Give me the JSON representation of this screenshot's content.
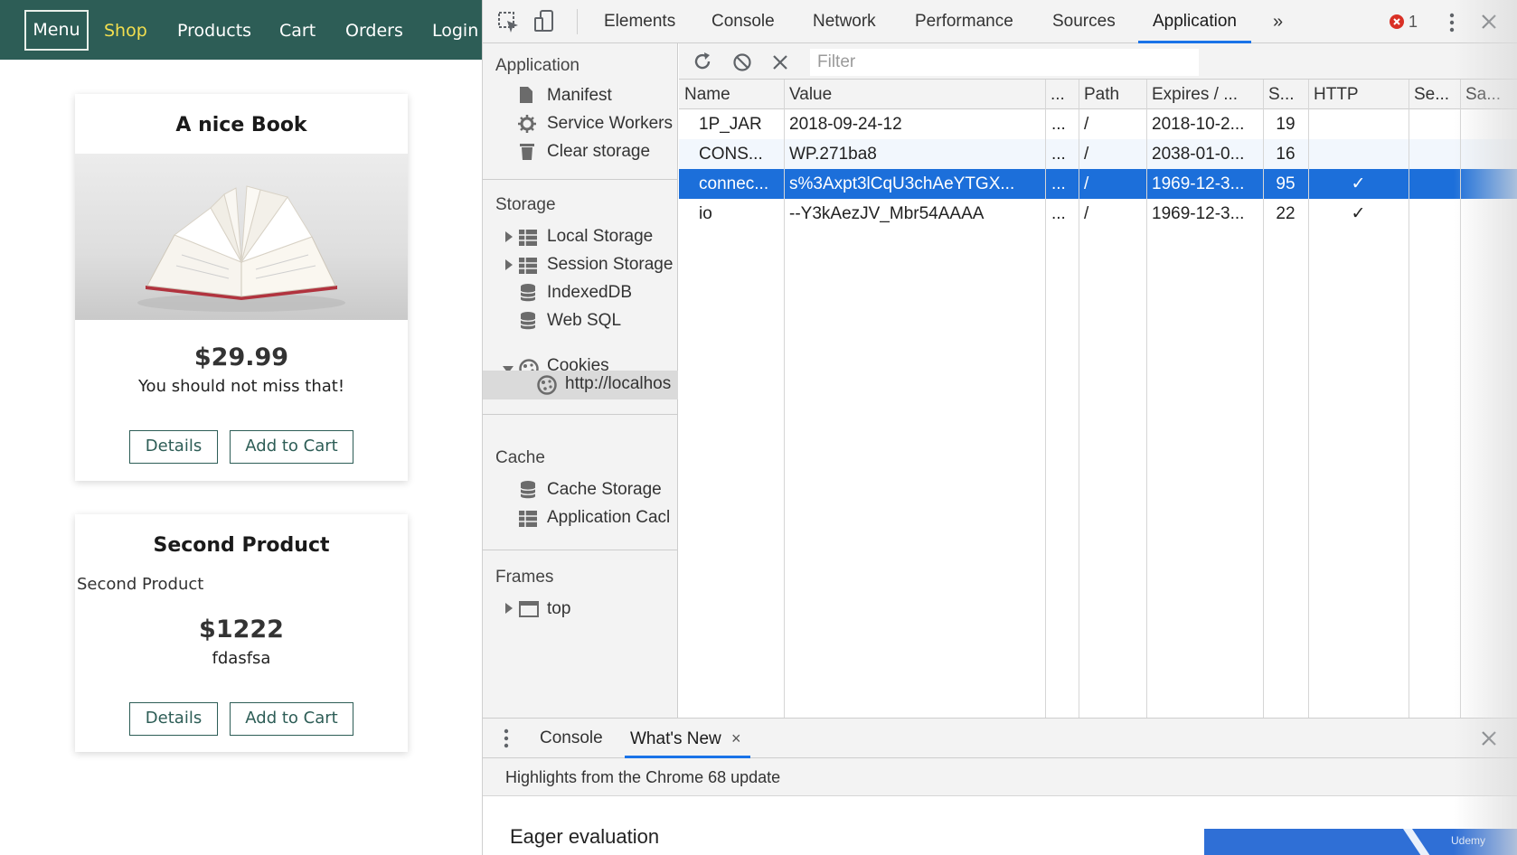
{
  "site": {
    "nav": {
      "menu": "Menu",
      "items": [
        "Shop",
        "Products",
        "Cart",
        "Orders",
        "Login"
      ],
      "active": "Shop"
    },
    "products": [
      {
        "title": "A nice Book",
        "image_alt": "",
        "image_icon": "open-book-image",
        "price": "$29.99",
        "description": "You should not miss that!",
        "details_label": "Details",
        "add_label": "Add to Cart"
      },
      {
        "title": "Second Product",
        "image_alt": "Second Product",
        "price": "$1222",
        "description": "fdasfsa",
        "details_label": "Details",
        "add_label": "Add to Cart"
      }
    ]
  },
  "devtools": {
    "tabs": [
      "Elements",
      "Console",
      "Network",
      "Performance",
      "Sources",
      "Application"
    ],
    "active_tab": "Application",
    "more_tabs": "»",
    "error_count": "1",
    "sidebar": {
      "application_header": "Application",
      "application_items": [
        "Manifest",
        "Service Workers",
        "Clear storage"
      ],
      "storage_header": "Storage",
      "storage_items": [
        "Local Storage",
        "Session Storage",
        "IndexedDB",
        "Web SQL",
        "Cookies"
      ],
      "cookie_origin": "http://localhos",
      "cache_header": "Cache",
      "cache_items": [
        "Cache Storage",
        "Application Cacl"
      ],
      "frames_header": "Frames",
      "frames_items": [
        "top"
      ]
    },
    "filter_placeholder": "Filter",
    "cookie_table": {
      "columns": [
        "Name",
        "Value",
        "...",
        "Path",
        "Expires / ...",
        "S...",
        "HTTP",
        "Se...",
        "Sa..."
      ],
      "rows": [
        {
          "name": "1P_JAR",
          "value": "2018-09-24-12",
          "domain": "...",
          "path": "/",
          "expires": "2018-10-2...",
          "size": "19",
          "http": ""
        },
        {
          "name": "CONS...",
          "value": "WP.271ba8",
          "domain": "...",
          "path": "/",
          "expires": "2038-01-0...",
          "size": "16",
          "http": ""
        },
        {
          "name": "connec...",
          "value": "s%3Axpt3lCqU3chAeYTGX...",
          "domain": "...",
          "path": "/",
          "expires": "1969-12-3...",
          "size": "95",
          "http": "✓"
        },
        {
          "name": "io",
          "value": "--Y3kAezJV_Mbr54AAAA",
          "domain": "...",
          "path": "/",
          "expires": "1969-12-3...",
          "size": "22",
          "http": "✓"
        }
      ],
      "selected_row": 2
    },
    "drawer": {
      "tabs": [
        "Console",
        "What's New"
      ],
      "active_tab": "What's New",
      "close_tab": "×",
      "highlights": "Highlights from the Chrome 68 update",
      "section_title": "Eager evaluation",
      "promo_text": "Udemy"
    },
    "colors": {
      "selected_row": "#1c6fda",
      "tab_indicator": "#1a73e8",
      "nav_bg": "#2d5d56",
      "nav_active": "#f3df4f",
      "error": "#d93025"
    }
  }
}
